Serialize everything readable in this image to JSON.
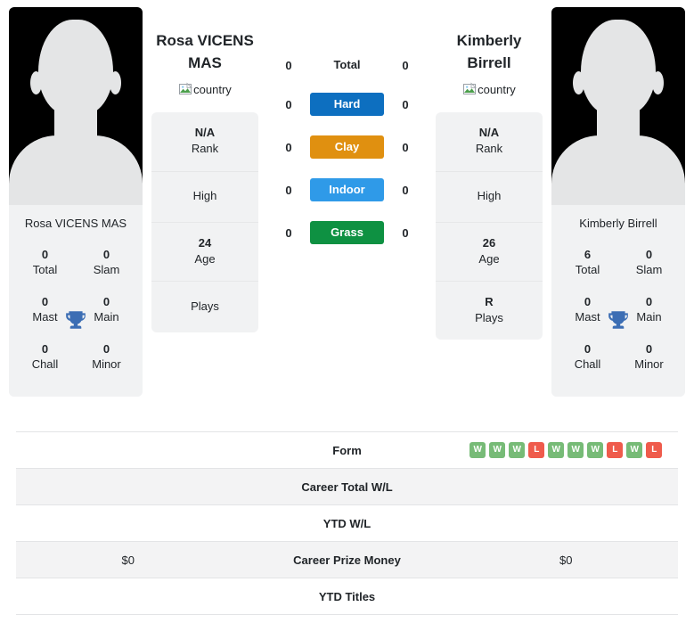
{
  "players": {
    "left": {
      "name": "Rosa VICENS MAS",
      "photo_caption": "Rosa VICENS MAS",
      "country_alt": "country",
      "titles": [
        {
          "value": "0",
          "label": "Total"
        },
        {
          "value": "0",
          "label": "Slam"
        },
        {
          "value": "0",
          "label": "Mast"
        },
        {
          "value": "0",
          "label": "Main"
        },
        {
          "value": "0",
          "label": "Chall"
        },
        {
          "value": "0",
          "label": "Minor"
        }
      ],
      "card": [
        {
          "value": "N/A",
          "label": "Rank"
        },
        {
          "value": "",
          "label": "High"
        },
        {
          "value": "24",
          "label": "Age"
        },
        {
          "value": "",
          "label": "Plays"
        }
      ]
    },
    "right": {
      "name": "Kimberly Birrell",
      "photo_caption": "Kimberly Birrell",
      "country_alt": "country",
      "titles": [
        {
          "value": "6",
          "label": "Total"
        },
        {
          "value": "0",
          "label": "Slam"
        },
        {
          "value": "0",
          "label": "Mast"
        },
        {
          "value": "0",
          "label": "Main"
        },
        {
          "value": "0",
          "label": "Chall"
        },
        {
          "value": "0",
          "label": "Minor"
        }
      ],
      "card": [
        {
          "value": "N/A",
          "label": "Rank"
        },
        {
          "value": "",
          "label": "High"
        },
        {
          "value": "26",
          "label": "Age"
        },
        {
          "value": "R",
          "label": "Plays"
        }
      ]
    }
  },
  "surfaces": [
    {
      "label": "Total",
      "left": "0",
      "right": "0",
      "badge": false,
      "color": ""
    },
    {
      "label": "Hard",
      "left": "0",
      "right": "0",
      "badge": true,
      "color": "#0d6fc0"
    },
    {
      "label": "Clay",
      "left": "0",
      "right": "0",
      "badge": true,
      "color": "#e09010"
    },
    {
      "label": "Indoor",
      "left": "0",
      "right": "0",
      "badge": true,
      "color": "#2f9ae8"
    },
    {
      "label": "Grass",
      "left": "0",
      "right": "0",
      "badge": true,
      "color": "#0e9142"
    }
  ],
  "stats": [
    {
      "label": "Form",
      "left": "",
      "right": "",
      "left_form": [],
      "right_form": [
        "W",
        "W",
        "W",
        "L",
        "W",
        "W",
        "W",
        "L",
        "W",
        "L"
      ],
      "alt": false
    },
    {
      "label": "Career Total W/L",
      "left": "",
      "right": "",
      "left_form": [],
      "right_form": [],
      "alt": true
    },
    {
      "label": "YTD W/L",
      "left": "",
      "right": "",
      "left_form": [],
      "right_form": [],
      "alt": false
    },
    {
      "label": "Career Prize Money",
      "left": "$0",
      "right": "$0",
      "left_form": [],
      "right_form": [],
      "alt": true
    },
    {
      "label": "YTD Titles",
      "left": "",
      "right": "",
      "left_form": [],
      "right_form": [],
      "alt": false
    }
  ],
  "colors": {
    "win": "#77bb77",
    "loss": "#ef5b4c",
    "card_bg": "#f1f2f3",
    "row_alt_bg": "#f3f3f4"
  }
}
